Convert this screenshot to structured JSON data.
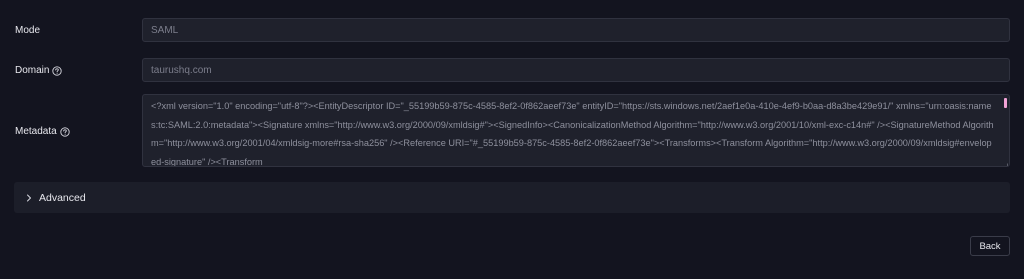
{
  "form": {
    "mode": {
      "label": "Mode",
      "value": "SAML"
    },
    "domain": {
      "label": "Domain",
      "value": "taurushq.com",
      "help_icon": "help-circle-icon"
    },
    "metadata": {
      "label": "Metadata",
      "help_icon": "help-circle-icon",
      "value": "<?xml version=\"1.0\" encoding=\"utf-8\"?><EntityDescriptor ID=\"_55199b59-875c-4585-8ef2-0f862aeef73e\" entityID=\"https://sts.windows.net/2aef1e0a-410e-4ef9-b0aa-d8a3be429e91/\" xmlns=\"urn:oasis:names:tc:SAML:2.0:metadata\"><Signature xmlns=\"http://www.w3.org/2000/09/xmldsig#\"><SignedInfo><CanonicalizationMethod Algorithm=\"http://www.w3.org/2001/10/xml-exc-c14n#\" /><SignatureMethod Algorithm=\"http://www.w3.org/2001/04/xmldsig-more#rsa-sha256\" /><Reference URI=\"#_55199b59-875c-4585-8ef2-0f862aeef73e\"><Transforms><Transform Algorithm=\"http://www.w3.org/2000/09/xmldsig#enveloped-signature\" /><Transform"
    }
  },
  "advanced": {
    "label": "Advanced",
    "icon": "chevron-right-icon"
  },
  "actions": {
    "back_label": "Back"
  },
  "colors": {
    "background": "#13141f",
    "input_background": "#1f212c",
    "scrollbar_accent": "#f2a3d6"
  }
}
